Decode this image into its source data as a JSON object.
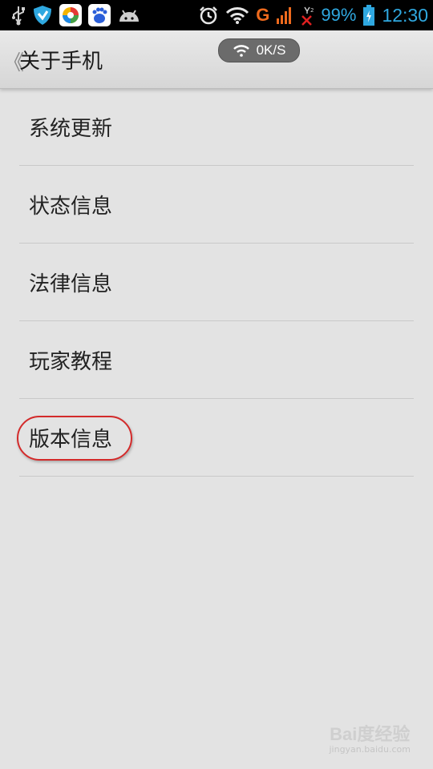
{
  "status_bar": {
    "left_icons": [
      "usb-icon",
      "shield-icon",
      "app-store-icon",
      "baidu-icon",
      "android-icon"
    ],
    "right_icons": [
      "alarm-icon",
      "wifi-icon",
      "network-g-icon",
      "signal-icon",
      "sim-missing-icon",
      "battery-icon"
    ],
    "network_type": "G",
    "battery_percent": "99%",
    "clock": "12:30",
    "accent_color": "#2fa8e0"
  },
  "header": {
    "back_glyph": "《",
    "title": "关于手机",
    "speed_indicator": "0K/S"
  },
  "list": {
    "items": [
      {
        "label": "系统更新"
      },
      {
        "label": "状态信息"
      },
      {
        "label": "法律信息"
      },
      {
        "label": "玩家教程"
      },
      {
        "label": "版本信息",
        "highlighted": true
      }
    ]
  },
  "watermark": {
    "main": "Bai度经验",
    "sub": "jingyan.baidu.com"
  }
}
